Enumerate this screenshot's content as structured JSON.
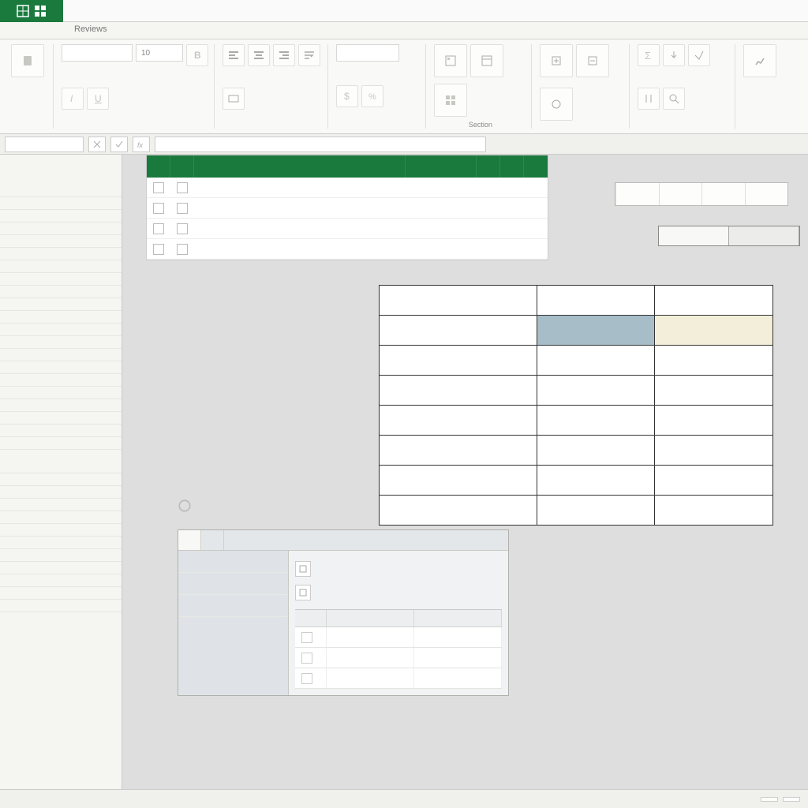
{
  "titlebar": {
    "app_label": ""
  },
  "tabs": [
    "Reviews"
  ],
  "ribbon": {
    "groups": [
      {
        "label": ""
      },
      {
        "label": ""
      },
      {
        "label": ""
      },
      {
        "label": ""
      },
      {
        "label": "Section"
      },
      {
        "label": ""
      },
      {
        "label": ""
      },
      {
        "label": ""
      }
    ],
    "fields": {
      "f1": "",
      "f2": "",
      "f3": "10"
    }
  },
  "fbar": {
    "cell_ref": ""
  },
  "sidebar": {
    "title1": "",
    "items": [
      "",
      "",
      "",
      "",
      "",
      "",
      "",
      "",
      "",
      "",
      "",
      "",
      "",
      "",
      "",
      "",
      "",
      "",
      "",
      "",
      "",
      "",
      "",
      "",
      "",
      "",
      "",
      "",
      "",
      "",
      "",
      "",
      ""
    ]
  },
  "task_panel": {
    "head": {
      "a": "",
      "b": "",
      "c": "",
      "d": "",
      "e": "",
      "f": ""
    },
    "rows": [
      {
        "label": "",
        "desc": ""
      },
      {
        "label": "",
        "desc": ""
      },
      {
        "label": "",
        "desc": ""
      },
      {
        "label": "",
        "desc": ""
      }
    ]
  },
  "right_tools": {
    "t1": "",
    "t2": "",
    "t3": "",
    "t4": ""
  },
  "right_tabs": {
    "a": "",
    "b": ""
  },
  "instruction": "",
  "dtable": {
    "headers": {
      "c1": "",
      "c2": "",
      "c3": ""
    },
    "sub": ""
  },
  "section": {
    "label": "",
    "sub": ""
  },
  "dialog": {
    "tabs": {
      "a": "",
      "b": ""
    },
    "left": [
      "",
      "",
      ""
    ],
    "right": {
      "row1": "",
      "row2": "",
      "grid_head": {
        "a": "",
        "b": "",
        "c": ""
      },
      "grid_rows": [
        {
          "a": "",
          "b": ""
        },
        {
          "a": "",
          "b": ""
        },
        {
          "a": "",
          "b": ""
        }
      ]
    }
  },
  "status": {
    "left": "",
    "page": "",
    "btn1": "",
    "btn2": ""
  }
}
